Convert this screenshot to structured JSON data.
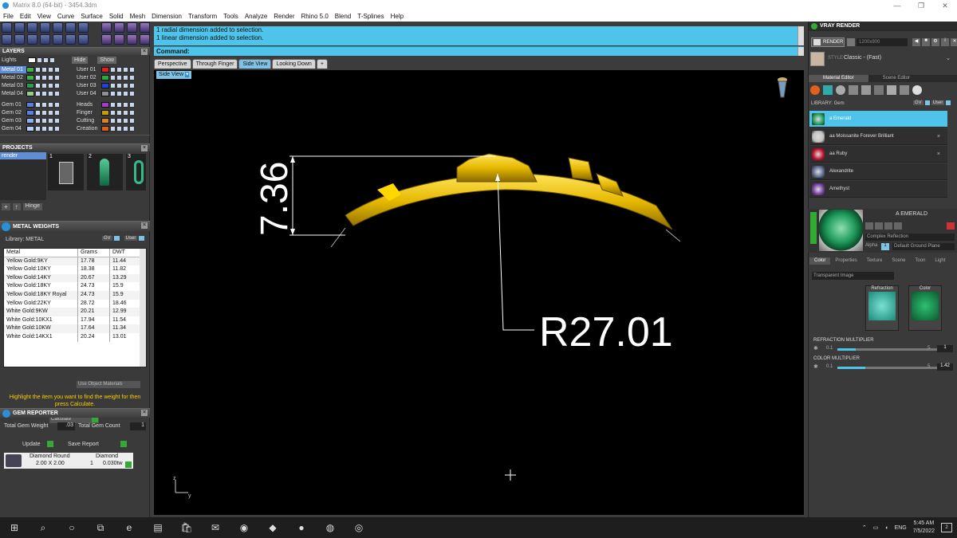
{
  "window": {
    "title": "Matrix 8.0 (64-bit) - 3454.3dm",
    "controls": [
      "—",
      "❐",
      "✕"
    ]
  },
  "menu": [
    "File",
    "Edit",
    "View",
    "Curve",
    "Surface",
    "Solid",
    "Mesh",
    "Dimension",
    "Transform",
    "Tools",
    "Analyze",
    "Render",
    "Rhino 5.0",
    "Blend",
    "T-Splines",
    "Help"
  ],
  "layers": {
    "title": "LAYERS",
    "lights_label": "Lights",
    "hide_label": "Hide",
    "show_label": "Show",
    "left": [
      {
        "name": "Metal 01",
        "color": "#3cb44a"
      },
      {
        "name": "Metal 02",
        "color": "#3cb44a"
      },
      {
        "name": "Metal 03",
        "color": "#2e9a5a"
      },
      {
        "name": "Metal 04",
        "color": "#8fd08a"
      },
      {
        "name": "Gem 01",
        "color": "#5a7fe0"
      },
      {
        "name": "Gem 02",
        "color": "#5a7fe0"
      },
      {
        "name": "Gem 03",
        "color": "#8fb0f0"
      },
      {
        "name": "Gem 04",
        "color": "#b8cff5"
      }
    ],
    "right": [
      {
        "name": "User 01",
        "color": "#e02020"
      },
      {
        "name": "User 02",
        "color": "#20b040"
      },
      {
        "name": "User 03",
        "color": "#2040e0"
      },
      {
        "name": "User 04",
        "color": "#909090"
      },
      {
        "name": "Heads",
        "color": "#a040c0"
      },
      {
        "name": "Finger",
        "color": "#c0a000"
      },
      {
        "name": "Cutting",
        "color": "#e08020"
      },
      {
        "name": "Creation",
        "color": "#e06010"
      }
    ]
  },
  "projects": {
    "title": "PROJECTS",
    "item": "render",
    "thumbs": [
      "1",
      "2",
      "3"
    ],
    "hinge_label": "Hinge"
  },
  "metal_weights": {
    "title": "METAL WEIGHTS",
    "library_label": "Library: METAL",
    "gv_label": "GV",
    "user_label": "User",
    "columns": [
      "Metal",
      "Grams",
      "DWT"
    ],
    "rows": [
      [
        "Yellow Gold:9KY",
        "17.78",
        "11.44"
      ],
      [
        "Yellow Gold:10KY",
        "18.38",
        "11.82"
      ],
      [
        "Yellow Gold:14KY",
        "20.67",
        "13.29"
      ],
      [
        "Yellow Gold:18KY",
        "24.73",
        "15.9"
      ],
      [
        "Yellow Gold:18KY Royal",
        "24.73",
        "15.9"
      ],
      [
        "Yellow Gold:22KY",
        "28.72",
        "18.46"
      ],
      [
        "White Gold:9KW",
        "20.21",
        "12.99"
      ],
      [
        "White Gold:10KX1",
        "17.94",
        "11.54"
      ],
      [
        "White Gold:10KW",
        "17.64",
        "11.34"
      ],
      [
        "White Gold:14KX1",
        "20.24",
        "13.01"
      ]
    ],
    "use_object_label": "Use Object Materials",
    "hint": "Highlight the item you want to find the weight for then press Calculate.",
    "calculate_label": "Calculate"
  },
  "gem_reporter": {
    "title": "GEM REPORTER",
    "total_weight_label": "Total Gem Weight",
    "total_weight_value": ".03",
    "total_count_label": "Total Gem Count",
    "total_count_value": "1",
    "update_label": "Update",
    "save_report_label": "Save Report",
    "gem_name": "Diamond Round",
    "gem_material": "Diamond",
    "gem_size": "2.00 X 2.00",
    "gem_count": "1",
    "gem_weight": "0.030tw"
  },
  "command": {
    "history": [
      "1 radial dimension added to selection.",
      "1 linear dimension added to selection."
    ],
    "label": "Command:"
  },
  "viewport_tabs": [
    "Perspective",
    "Through Finger",
    "Side View",
    "Looking Down"
  ],
  "active_tab": "Side View",
  "viewport_label": "Side View",
  "dimensions": {
    "linear": "7.36",
    "radial": "R27.01"
  },
  "axis_labels": {
    "z": "z",
    "y": "y"
  },
  "vray": {
    "title": "VRAY RENDER",
    "render_label": "RENDER",
    "resolution": "1200x900",
    "style_label": "STYLE",
    "style_value": "Classic - (Fast)",
    "tabs": [
      "Material Editor",
      "Scene Editor"
    ],
    "library_label": "LIBRARY: Gem",
    "gv_label": "GV",
    "user_label": "User",
    "materials": [
      {
        "name": "a Emerald",
        "color": "#1e9a5a"
      },
      {
        "name": "aa Moissanite Forever Brilliant",
        "color": "#c0c0c0"
      },
      {
        "name": "aa Ruby",
        "color": "#c01030"
      },
      {
        "name": "Alexandrite",
        "color": "#5a6a90"
      },
      {
        "name": "Amethyst",
        "color": "#7040a0"
      }
    ],
    "selected_material": "A EMERALD",
    "reflection": "Complex Reflection",
    "alpha_label": "Alpha",
    "alpha_value": "1",
    "ground_plane": "Default Ground Plane",
    "sub_tabs": [
      "Color",
      "Properties",
      "Texture",
      "Scene",
      "Toon",
      "Light"
    ],
    "transparent_image": "Transparent Image",
    "refraction_label": "Refraction",
    "color_label": "Color",
    "refraction_multiplier_label": "REFRACTION MULTIPLIER",
    "refraction_min": "0.1",
    "refraction_max": "5",
    "refraction_value": "1",
    "refraction_level": 0.18,
    "color_multiplier_label": "COLOR MULTIPLIER",
    "color_min": "0.1",
    "color_max": "5",
    "color_value": "1.42",
    "color_level": 0.27
  },
  "taskbar": {
    "icons": [
      "windows-icon",
      "search-icon",
      "cortana-icon",
      "taskview-icon",
      "edge-icon",
      "explorer-icon",
      "store-icon",
      "mail-icon",
      "chrome-icon",
      "app-icon",
      "app2-icon",
      "rhino-icon",
      "matrix-icon"
    ],
    "lang": "ENG",
    "time": "5:45 AM",
    "date": "7/5/2022",
    "notify_count": "2"
  },
  "colors": {
    "cmd_bg": "#4fc4ea",
    "gold": "#e6b800",
    "accent": "#4fc4ea"
  }
}
